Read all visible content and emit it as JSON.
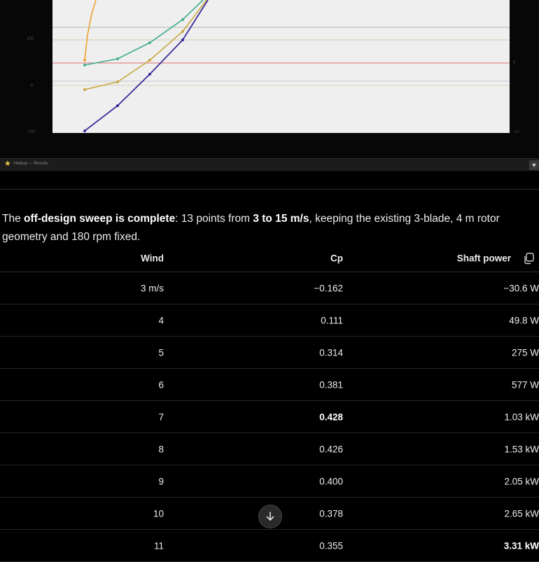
{
  "screenshot_panel": {
    "left_ticks": [
      "100",
      "0",
      "-100"
    ],
    "right_ticks": [
      "0",
      "-10"
    ],
    "caption": "Hebcat — Results",
    "series_colors": {
      "orange": "#f0a030",
      "green": "#3fae8e",
      "gold": "#c8a840",
      "indigo": "#3a2a9a"
    }
  },
  "summary": {
    "part1": "The ",
    "bold1": "off-design sweep is complete",
    "part2": ": 13 points from ",
    "bold2": "3 to 15 m/s",
    "part3": ", keeping the existing 3-blade, 4 m rotor geometry and 180 rpm fixed."
  },
  "table": {
    "headers": {
      "wind": "Wind",
      "cp": "Cp",
      "power": "Shaft power"
    },
    "rows": [
      {
        "wind": "3 m/s",
        "cp": "−0.162",
        "power": "−30.6 W",
        "cp_bold": false,
        "power_bold": false
      },
      {
        "wind": "4",
        "cp": "0.111",
        "power": "49.8 W",
        "cp_bold": false,
        "power_bold": false
      },
      {
        "wind": "5",
        "cp": "0.314",
        "power": "275 W",
        "cp_bold": false,
        "power_bold": false
      },
      {
        "wind": "6",
        "cp": "0.381",
        "power": "577 W",
        "cp_bold": false,
        "power_bold": false
      },
      {
        "wind": "7",
        "cp": "0.428",
        "power": "1.03 kW",
        "cp_bold": true,
        "power_bold": false
      },
      {
        "wind": "8",
        "cp": "0.426",
        "power": "1.53 kW",
        "cp_bold": false,
        "power_bold": false
      },
      {
        "wind": "9",
        "cp": "0.400",
        "power": "2.05 kW",
        "cp_bold": false,
        "power_bold": false
      },
      {
        "wind": "10",
        "cp": "0.378",
        "power": "2.65 kW",
        "cp_bold": false,
        "power_bold": false
      },
      {
        "wind": "11",
        "cp": "0.355",
        "power": "3.31 kW",
        "cp_bold": false,
        "power_bold": true
      }
    ]
  }
}
